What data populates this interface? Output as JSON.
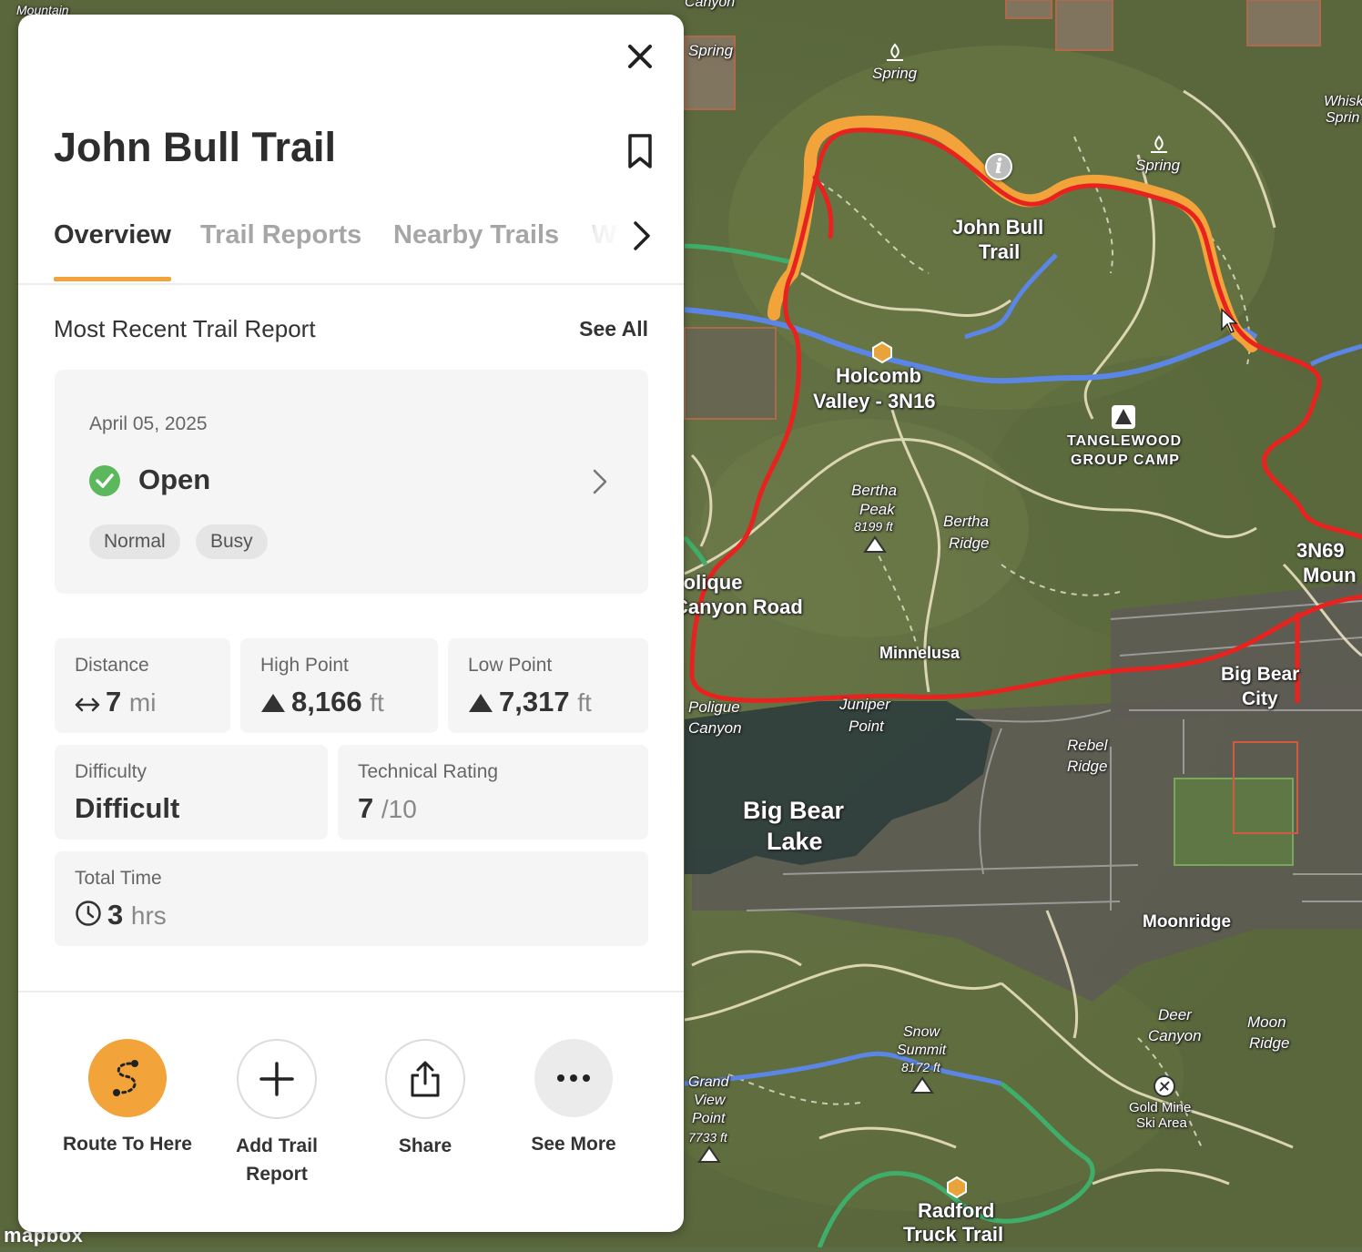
{
  "map": {
    "labels": [
      {
        "id": "spring-1",
        "text": "Spring"
      },
      {
        "id": "spring-2",
        "text": "Spring"
      },
      {
        "id": "spring-3",
        "text": "Spring"
      },
      {
        "id": "john-bull-1",
        "text": "John Bull"
      },
      {
        "id": "john-bull-2",
        "text": "Trail"
      },
      {
        "id": "holcomb-1",
        "text": "Holcomb"
      },
      {
        "id": "holcomb-2",
        "text": "Valley - 3N16"
      },
      {
        "id": "tanglewood-1",
        "text": "TANGLEWOOD"
      },
      {
        "id": "tanglewood-2",
        "text": "GROUP CAMP"
      },
      {
        "id": "bertha-peak-1",
        "text": "Bertha"
      },
      {
        "id": "bertha-peak-2",
        "text": "Peak"
      },
      {
        "id": "bertha-peak-3",
        "text": "8199 ft"
      },
      {
        "id": "bertha-ridge-1",
        "text": "Bertha"
      },
      {
        "id": "bertha-ridge-2",
        "text": "Ridge"
      },
      {
        "id": "polique-1",
        "text": "Polique"
      },
      {
        "id": "polique-2",
        "text": "Canyon Road"
      },
      {
        "id": "minnelusa",
        "text": "Minnelusa"
      },
      {
        "id": "poligue-1",
        "text": "Poligue"
      },
      {
        "id": "poligue-2",
        "text": "Canyon"
      },
      {
        "id": "juniper-1",
        "text": "Juniper"
      },
      {
        "id": "juniper-2",
        "text": "Point"
      },
      {
        "id": "rebel-1",
        "text": "Rebel"
      },
      {
        "id": "rebel-2",
        "text": "Ridge"
      },
      {
        "id": "bigbear-lake-1",
        "text": "Big Bear"
      },
      {
        "id": "bigbear-lake-2",
        "text": "Lake"
      },
      {
        "id": "bigbear-city-1",
        "text": "Big Bear"
      },
      {
        "id": "bigbear-city-2",
        "text": "City"
      },
      {
        "id": "3n69",
        "text": "3N69"
      },
      {
        "id": "moun",
        "text": "Moun"
      },
      {
        "id": "moonridge",
        "text": "Moonridge"
      },
      {
        "id": "deer-1",
        "text": "Deer"
      },
      {
        "id": "deer-2",
        "text": "Canyon"
      },
      {
        "id": "moon-ridge-1",
        "text": "Moon"
      },
      {
        "id": "moon-ridge-2",
        "text": "Ridge"
      },
      {
        "id": "snow-1",
        "text": "Snow"
      },
      {
        "id": "snow-2",
        "text": "Summit"
      },
      {
        "id": "snow-3",
        "text": "8172 ft"
      },
      {
        "id": "goldmine-1",
        "text": "Gold Mine"
      },
      {
        "id": "goldmine-2",
        "text": "Ski Area"
      },
      {
        "id": "grand-1",
        "text": "Grand"
      },
      {
        "id": "grand-2",
        "text": "View"
      },
      {
        "id": "grand-3",
        "text": "Point"
      },
      {
        "id": "grand-4",
        "text": "7733 ft"
      },
      {
        "id": "radford-1",
        "text": "Radford"
      },
      {
        "id": "radford-2",
        "text": "Truck Trail"
      },
      {
        "id": "whisk-1",
        "text": "Whisk"
      },
      {
        "id": "whisk-2",
        "text": "Sprin"
      },
      {
        "id": "mountain",
        "text": "Mountain"
      },
      {
        "id": "canyon-top",
        "text": "Canyon"
      }
    ],
    "attribution": "mapbox"
  },
  "panel": {
    "title": "John Bull Trail",
    "tabs": [
      "Overview",
      "Trail Reports",
      "Nearby Trails",
      "W"
    ],
    "active_tab": "Overview",
    "report_section": {
      "title": "Most Recent Trail Report",
      "see_all": "See All",
      "date": "April 05, 2025",
      "status": "Open",
      "tags": [
        "Normal",
        "Busy"
      ]
    },
    "stats": {
      "distance": {
        "label": "Distance",
        "value": "7",
        "unit": "mi"
      },
      "high_point": {
        "label": "High Point",
        "value": "8,166",
        "unit": "ft"
      },
      "low_point": {
        "label": "Low Point",
        "value": "7,317",
        "unit": "ft"
      },
      "difficulty": {
        "label": "Difficulty",
        "value": "Difficult"
      },
      "technical_rating": {
        "label": "Technical Rating",
        "value": "7",
        "unit": "/10"
      },
      "total_time": {
        "label": "Total Time",
        "value": "3",
        "unit": "hrs"
      }
    },
    "actions": [
      {
        "label": "Route To Here",
        "icon": "route-icon"
      },
      {
        "label": "Add Trail Report",
        "icon": "plus-icon"
      },
      {
        "label": "Share",
        "icon": "share-icon"
      },
      {
        "label": "See More",
        "icon": "more-icon"
      }
    ]
  },
  "colors": {
    "accent": "#f2a33a",
    "open_green": "#5cb85c",
    "trail_red": "#e8231f",
    "trail_orange": "#f2a33a",
    "trail_blue": "#5b86e5",
    "trail_green": "#3fae6a"
  }
}
